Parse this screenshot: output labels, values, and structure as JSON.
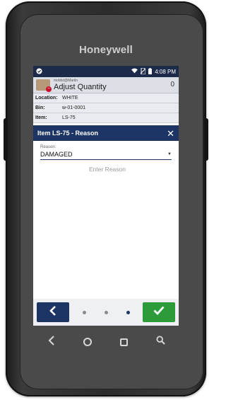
{
  "device": {
    "brand": "Honeywell"
  },
  "statusbar": {
    "time": "4:08 PM"
  },
  "app": {
    "subtitle": "mobtst@Martin",
    "title": "Adjust Quantity",
    "count": "0"
  },
  "info": [
    {
      "key": "Location:",
      "value": "WHITE"
    },
    {
      "key": "Bin:",
      "value": "w-01-0001"
    },
    {
      "key": "Item:",
      "value": "LS-75"
    }
  ],
  "dialog": {
    "title": "Item LS-75 - Reason",
    "reason_label": "Reason:",
    "reason_value": "DAMAGED",
    "reason_placeholder": "Enter Reason"
  },
  "icons": {
    "back": "chevron-left-icon",
    "confirm": "checkmark-icon",
    "close": "close-icon"
  },
  "colors": {
    "primary": "#1d3564",
    "confirm": "#2e9b3a",
    "statusbar": "#1d2b4a"
  }
}
